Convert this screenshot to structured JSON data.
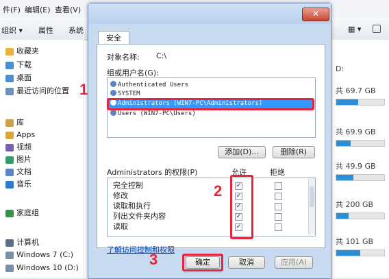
{
  "explorer": {
    "menu": [
      "件(F)",
      "编辑(E)",
      "查看(V)"
    ],
    "toolbar": [
      "组织 ▾",
      "属性",
      "系统"
    ],
    "sidebar": [
      {
        "label": "收藏夹",
        "icon": "star-icon"
      },
      {
        "label": "下载",
        "icon": "download-folder-icon"
      },
      {
        "label": "桌面",
        "icon": "desktop-icon"
      },
      {
        "label": "最近访问的位置",
        "icon": "recent-places-icon"
      },
      {
        "label": "库",
        "icon": "library-icon"
      },
      {
        "label": "Apps",
        "icon": "apps-folder-icon"
      },
      {
        "label": "视频",
        "icon": "video-library-icon"
      },
      {
        "label": "图片",
        "icon": "pictures-library-icon"
      },
      {
        "label": "文档",
        "icon": "documents-library-icon"
      },
      {
        "label": "音乐",
        "icon": "music-library-icon"
      },
      {
        "label": "家庭组",
        "icon": "homegroup-icon"
      },
      {
        "label": "计算机",
        "icon": "computer-icon"
      },
      {
        "label": "Windows 7 (C:)",
        "icon": "drive-icon"
      },
      {
        "label": "Windows 10 (D:)",
        "icon": "drive-icon"
      }
    ],
    "drives": [
      {
        "text": "D:",
        "fill": 0
      },
      {
        "text": "共 69.7 GB",
        "fill": 0.45
      },
      {
        "text": "共 69.9 GB",
        "fill": 0.3
      },
      {
        "text": "共 49.9 GB",
        "fill": 0.35
      },
      {
        "text": "共 200 GB",
        "fill": 0.25
      },
      {
        "text": "共 101 GB",
        "fill": 0.5
      }
    ],
    "colors": {
      "drive_fill": "#2a8fd6"
    }
  },
  "dialog": {
    "close_label": "✕",
    "tab": "安全",
    "object_label": "对象名称:",
    "object_value": "C:\\",
    "groups_label": "组或用户名(G):",
    "users": [
      "Authenticated Users",
      "SYSTEM",
      "Administrators (WIN7-PC\\Administrators)",
      "Users (WIN7-PC\\Users)"
    ],
    "add_button": "添加(D)...",
    "remove_button": "删除(R)",
    "perm_header": "Administrators 的权限(P)",
    "allow_header": "允许",
    "deny_header": "拒绝",
    "permissions": [
      {
        "name": "完全控制",
        "allow": true,
        "deny": false
      },
      {
        "name": "修改",
        "allow": true,
        "deny": false
      },
      {
        "name": "读取和执行",
        "allow": true,
        "deny": false
      },
      {
        "name": "列出文件夹内容",
        "allow": true,
        "deny": false
      },
      {
        "name": "读取",
        "allow": true,
        "deny": false
      }
    ],
    "advanced_link": "了解访问控制和权限",
    "ok_button": "确定",
    "cancel_button": "取消",
    "apply_button": "应用(A)"
  },
  "annotations": {
    "step1": "1",
    "step2": "2",
    "step3": "3"
  },
  "colors": {
    "highlight": "#e8243a",
    "selection": "#3399ff"
  }
}
